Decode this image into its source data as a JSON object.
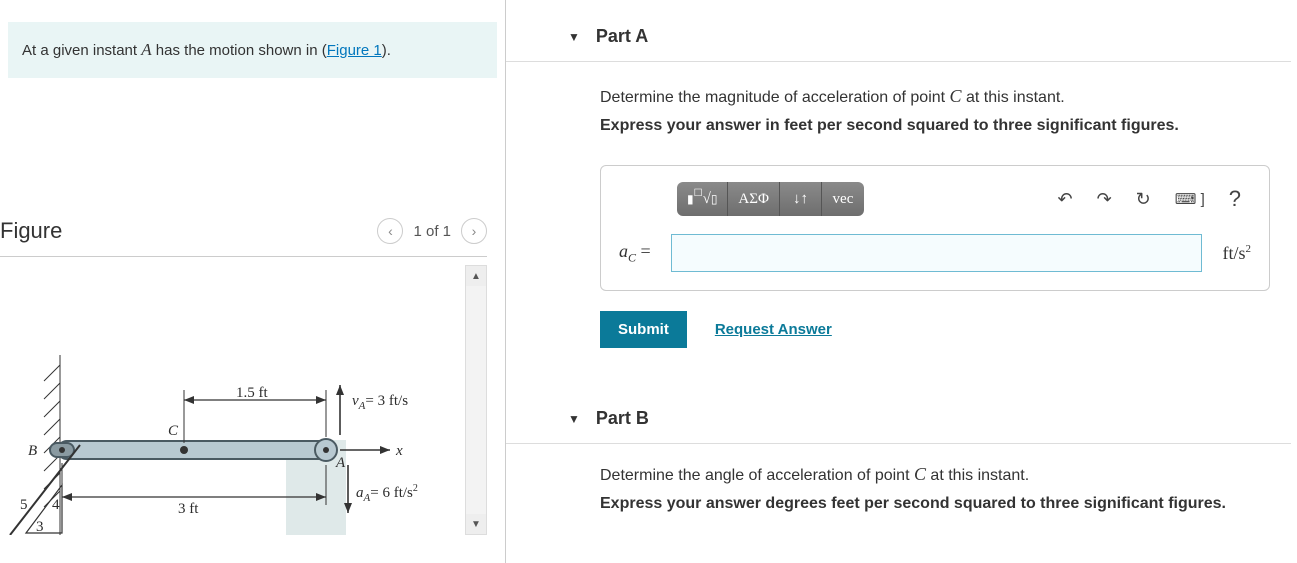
{
  "intro": {
    "prefix": "At a given instant ",
    "var": "A",
    "middle": " has the motion shown in (",
    "link": "Figure 1",
    "suffix": ")."
  },
  "figure": {
    "title": "Figure",
    "pager": "1 of 1",
    "labels": {
      "B": "B",
      "C": "C",
      "A": "A",
      "x": "x",
      "len_top": "1.5 ft",
      "len_bottom": "3 ft",
      "vA": "v",
      "vA_sub": "A",
      "vA_eq": "= 3 ft/s",
      "aA": "a",
      "aA_sub": "A",
      "aA_eq": "= 6 ft/s",
      "sq": "2",
      "angle_top": "5",
      "angle_bot": "4",
      "angle_hyp": "3"
    }
  },
  "partA": {
    "title": "Part A",
    "prompt_pre": "Determine the magnitude of acceleration of point ",
    "prompt_var": "C",
    "prompt_post": " at this instant.",
    "bold": "Express your answer in feet per second squared to three significant figures.",
    "toolbar": {
      "templates": "▮√▯",
      "greek": "ΑΣΦ",
      "subsup": "↓↑",
      "vec": "vec",
      "undo": "↶",
      "redo": "↷",
      "reset": "↻",
      "keyboard": "⌨ ]",
      "help": "?"
    },
    "lhs_var": "a",
    "lhs_sub": "C",
    "lhs_eq": " =",
    "unit_pre": "ft/s",
    "unit_sup": "2",
    "submit": "Submit",
    "request": "Request Answer",
    "value": ""
  },
  "partB": {
    "title": "Part B",
    "prompt_pre": "Determine the angle of acceleration of point ",
    "prompt_var": "C",
    "prompt_post": " at this instant.",
    "bold": "Express your answer degrees feet per second squared to three significant figures."
  }
}
